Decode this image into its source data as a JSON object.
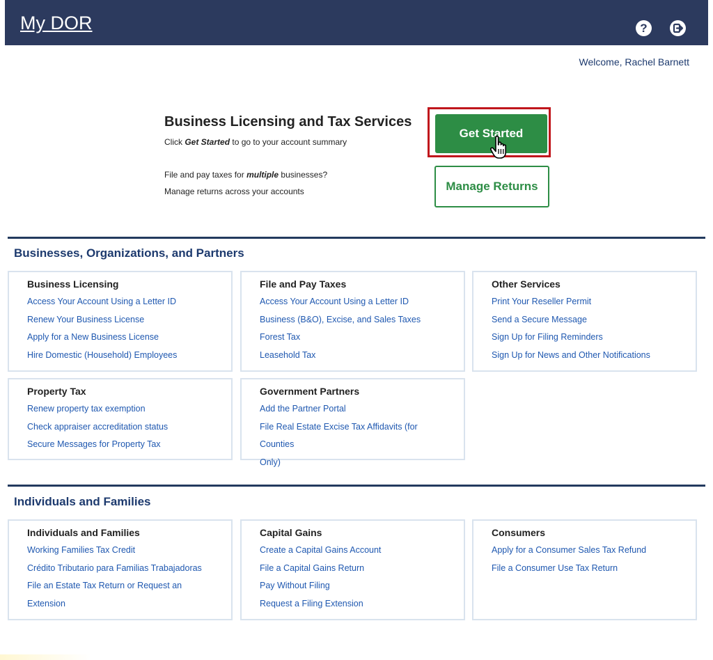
{
  "header": {
    "brand": "My DOR",
    "help_icon": "question-circle-icon",
    "logout_icon": "sign-out-icon",
    "welcome": "Welcome, Rachel Barnett"
  },
  "hero": {
    "title": "Business Licensing and Tax Services",
    "line1_pre": "Click ",
    "line1_em": "Get Started",
    "line1_post": " to go to your account summary",
    "line2_pre": "File and pay taxes for ",
    "line2_em": "multiple",
    "line2_post": " businesses?",
    "line3": "Manage returns across your accounts",
    "get_started": "Get Started",
    "manage_returns": "Manage Returns",
    "cursor_icon": "pointer-hand-icon"
  },
  "sections": [
    {
      "title": "Businesses, Organizations, and Partners",
      "cards": [
        {
          "title": "Business Licensing",
          "links": [
            "Access Your Account Using a Letter ID",
            "Renew Your Business License",
            "Apply for a New Business License",
            "Hire Domestic (Household) Employees"
          ]
        },
        {
          "title": "File and Pay Taxes",
          "links": [
            "Access Your Account Using a Letter ID",
            "Business (B&O), Excise, and Sales Taxes",
            "Forest Tax",
            "Leasehold Tax"
          ]
        },
        {
          "title": "Other Services",
          "links": [
            "Print Your Reseller Permit",
            "Send a Secure Message",
            "Sign Up for Filing Reminders",
            "Sign Up for News and Other Notifications"
          ]
        },
        {
          "title": "Property Tax",
          "links": [
            "Renew property tax exemption",
            "Check appraiser accreditation status",
            "Secure Messages for Property Tax"
          ]
        },
        {
          "title": "Government Partners",
          "links": [
            "Add the Partner Portal",
            "File Real Estate Excise Tax Affidavits (for Counties",
            "Only)"
          ]
        }
      ]
    },
    {
      "title": "Individuals and Families",
      "cards": [
        {
          "title": "Individuals and Families",
          "links": [
            "Working Families Tax Credit",
            "Crédito Tributario para Familias Trabajadoras",
            "File an Estate Tax Return or Request an Extension"
          ]
        },
        {
          "title": "Capital Gains",
          "links": [
            "Create a Capital Gains Account",
            "File a Capital Gains Return",
            "Pay Without Filing",
            "Request a Filing Extension"
          ]
        },
        {
          "title": "Consumers",
          "links": [
            "Apply for a Consumer Sales Tax Refund",
            "File a Consumer Use Tax Return"
          ]
        }
      ]
    }
  ],
  "colors": {
    "header_bg": "#2c3a5e",
    "accent_green": "#2d8d45",
    "link_blue": "#1f58b0",
    "highlight_red": "#c0161c"
  }
}
